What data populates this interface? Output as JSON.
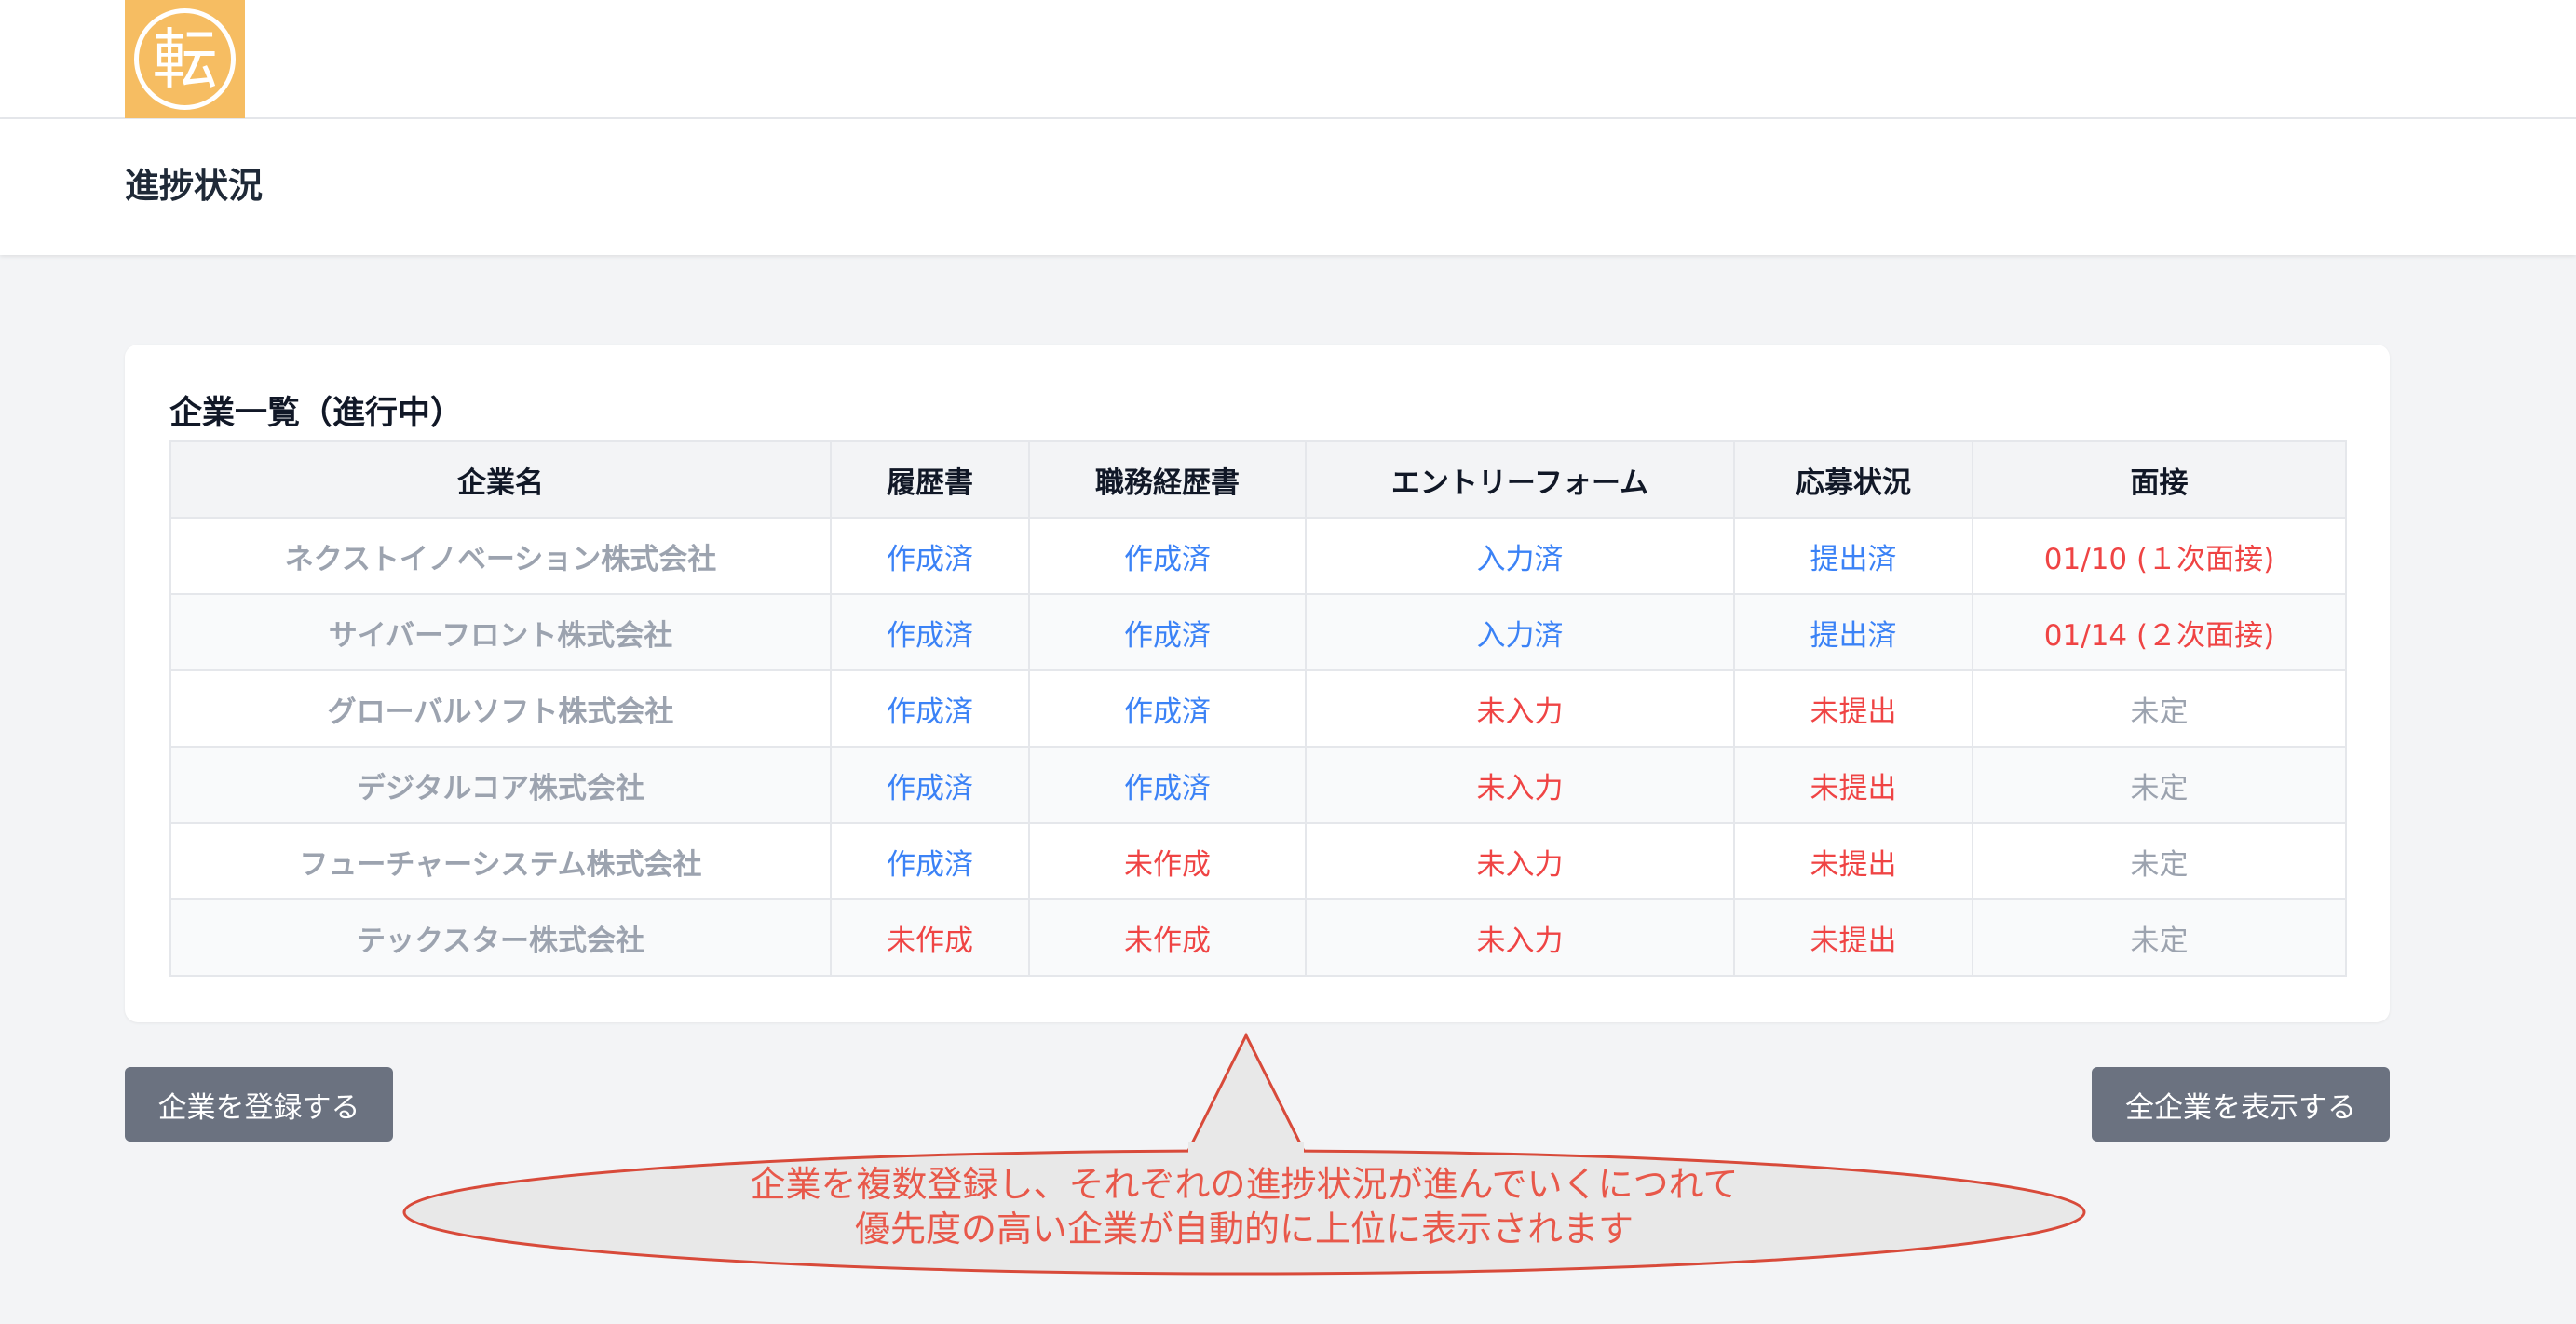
{
  "brand": {
    "logo_char": "転",
    "color": "#f6bd62"
  },
  "header": {
    "title": "進捗状況"
  },
  "card": {
    "title": "企業一覧（進行中）",
    "columns": [
      "企業名",
      "履歴書",
      "職務経歴書",
      "エントリーフォーム",
      "応募状況",
      "面接"
    ],
    "rows": [
      {
        "company": "ネクストイノベーション株式会社",
        "resume": "作成済",
        "cv": "作成済",
        "entry": "入力済",
        "application": "提出済",
        "interview": "01/10 (１次面接)"
      },
      {
        "company": "サイバーフロント株式会社",
        "resume": "作成済",
        "cv": "作成済",
        "entry": "入力済",
        "application": "提出済",
        "interview": "01/14 (２次面接)"
      },
      {
        "company": "グローバルソフト株式会社",
        "resume": "作成済",
        "cv": "作成済",
        "entry": "未入力",
        "application": "未提出",
        "interview": "未定"
      },
      {
        "company": "デジタルコア株式会社",
        "resume": "作成済",
        "cv": "作成済",
        "entry": "未入力",
        "application": "未提出",
        "interview": "未定"
      },
      {
        "company": "フューチャーシステム株式会社",
        "resume": "作成済",
        "cv": "未作成",
        "entry": "未入力",
        "application": "未提出",
        "interview": "未定"
      },
      {
        "company": "テックスター株式会社",
        "resume": "未作成",
        "cv": "未作成",
        "entry": "未入力",
        "application": "未提出",
        "interview": "未定"
      }
    ]
  },
  "buttons": {
    "register": "企業を登録する",
    "show_all": "全企業を表示する"
  },
  "callout": {
    "line1": "企業を複数登録し、それぞれの進捗状況が進んでいくにつれて",
    "line2": "優先度の高い企業が自動的に上位に表示されます"
  },
  "colors": {
    "done": "#3b82f6",
    "todo": "#ef4444",
    "pending": "#9ca3af",
    "callout": "#e8584a"
  }
}
